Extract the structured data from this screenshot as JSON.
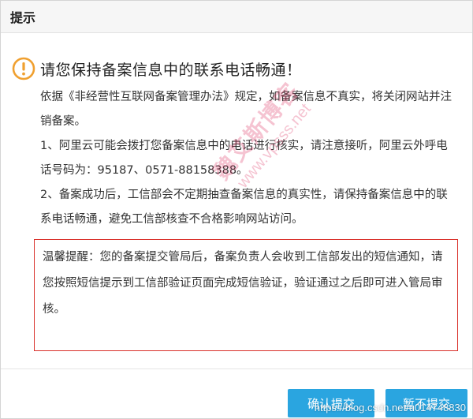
{
  "dialog": {
    "title": "提示"
  },
  "content": {
    "headline": "请您保持备案信息中的联系电话畅通！",
    "paragraph_1": "依据《非经营性互联网备案管理办法》规定，如备案信息不真实，将关闭网站并注销备案。",
    "paragraph_2": "1、阿里云可能会拨打您备案信息中的电话进行核实，请注意接听，阿里云外呼电话号码为：95187、0571-88158388。",
    "paragraph_3": "2、备案成功后，工信部会不定期抽查备案信息的真实性，请保持备案信息中的联系电话畅通，避免工信部核查不合格影响网站访问。"
  },
  "notice": {
    "text": "温馨提醒：您的备案提交管局后，备案负责人会收到工信部发出的短信通知，请您按照短信提示到工信部验证页面完成短信验证，验证通过之后即可进入管局审核。"
  },
  "buttons": {
    "confirm": "确认提交",
    "later": "暂不提交"
  },
  "watermark": {
    "name": "魏艾斯博客",
    "url": "www.vpsss.net"
  },
  "overlay": {
    "csdn": "https://blog.csdn.net/u014748830"
  },
  "colors": {
    "warning_icon": "#f0a030",
    "notice_border": "#d9302a",
    "primary_button": "#2aa5e0"
  },
  "icons": {
    "warning": "exclamation-circle-icon"
  }
}
